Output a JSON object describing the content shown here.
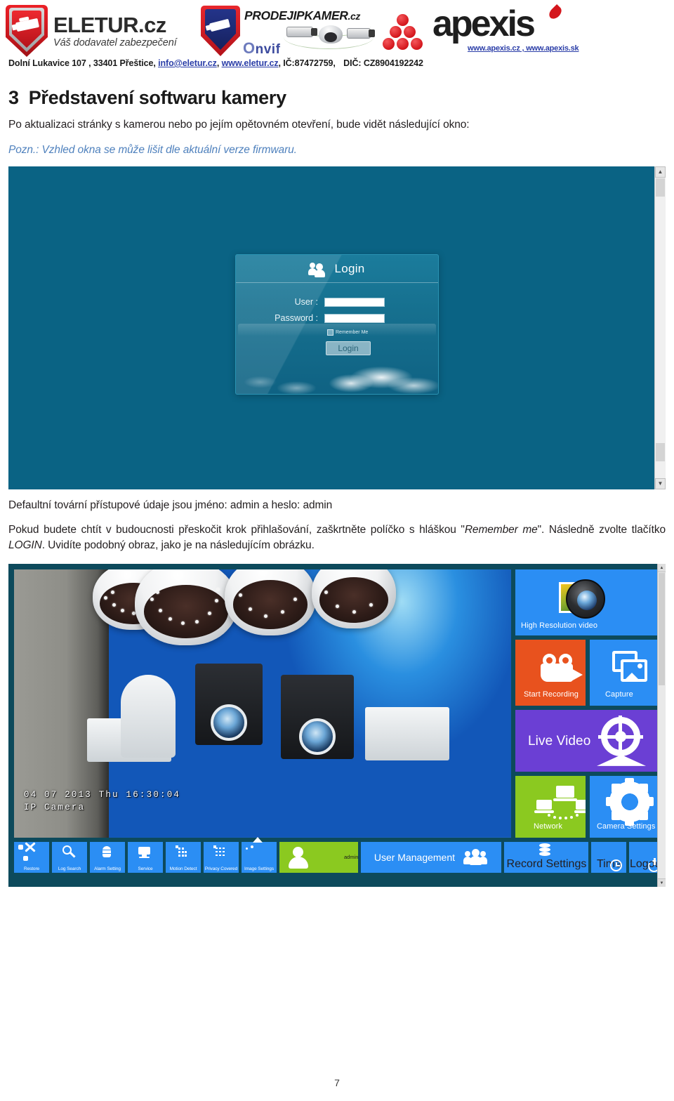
{
  "letterhead": {
    "eletur": {
      "name": "ELETUR.cz",
      "tagline": "Váš dodavatel zabezpečení"
    },
    "prodej": {
      "title": "PRODEJIPKAMER",
      "suffix": ".cz",
      "onvif": "Onvif"
    },
    "apexis": {
      "word": "apexis",
      "urls": "www.apexis.cz , www.apexis.sk"
    },
    "address_pre": "Dolní Lukavice 107 , 33401 Přeštice,",
    "email": "info@eletur.cz",
    "comma1": ",",
    "web": "www.eletur.cz",
    "ico": ", IČ:87472759,",
    "dic": "DIČ: CZ8904192242"
  },
  "document": {
    "heading_number": "3",
    "heading_text": "Představení softwaru kamery",
    "paragraph1": "Po aktualizaci stránky s kamerou nebo po jejím opětovném otevření, bude vidět následující okno:",
    "note": "Pozn.: Vzhled okna se může lišit dle aktuální verze firmwaru.",
    "paragraph2": "Defaultní tovární přístupové údaje jsou jméno: admin a heslo: admin",
    "paragraph3_a": "Pokud budete chtít v budoucnosti přeskočit krok přihlašování, zaškrtněte políčko s hláškou \"",
    "paragraph3_em1": "Remember me",
    "paragraph3_b": "\". Následně zvolte tlačítko ",
    "paragraph3_em2": "LOGIN",
    "paragraph3_c": ". Uvidíte podobný obraz, jako je na následujícím obrázku.",
    "page_number": "7"
  },
  "login_screen": {
    "title": "Login",
    "user_label": "User :",
    "password_label": "Password :",
    "user_value": "",
    "password_value": "",
    "remember_label": "Remember Me",
    "button_label": "Login",
    "background_color": "#0a6384"
  },
  "camera_ui": {
    "osd_line1": "04 07 2013 Thu 16:30:04",
    "osd_line2": "IP Camera",
    "tiles": [
      {
        "label": "High Resolution video",
        "icon": "camera-lens-icon",
        "color": "#2b8ef4"
      },
      {
        "label": "Start Recording",
        "icon": "video-camera-icon",
        "color": "#e8521e"
      },
      {
        "label": "Capture",
        "icon": "photos-icon",
        "color": "#2b8ef4"
      },
      {
        "label": "Live Video",
        "icon": "webcam-icon",
        "color": "#6b3fd4"
      },
      {
        "label": "Network",
        "icon": "network-icon",
        "color": "#8bc920"
      },
      {
        "label": "Camera Settings",
        "icon": "gear-icon",
        "color": "#2b8ef4"
      }
    ],
    "toolbar": [
      {
        "label": "Restore",
        "icon": "wrench-screwdriver-icon"
      },
      {
        "label": "Log Search",
        "icon": "magnifier-icon"
      },
      {
        "label": "Alarm Setting",
        "icon": "bell-icon"
      },
      {
        "label": "Service",
        "icon": "monitor-folder-icon"
      },
      {
        "label": "Motion Detect",
        "icon": "motion-grid-icon"
      },
      {
        "label": "Privacy Covered",
        "icon": "privacy-grid-icon"
      },
      {
        "label": "Image Settings",
        "icon": "picture-icon"
      }
    ],
    "current_user": "admin",
    "user_management_label": "User Management",
    "record_settings_label": "Record Settings",
    "time_label": "Time",
    "logout_label": "Logout",
    "frame_color": "#0d4a5c"
  }
}
